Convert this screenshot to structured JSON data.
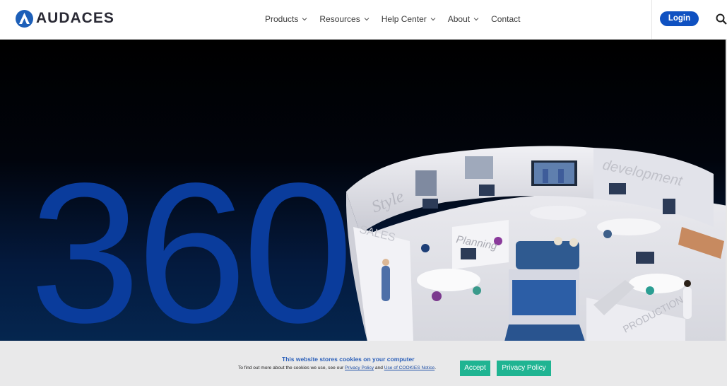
{
  "brand": {
    "name": "AUDACES",
    "color": "#1d5fb8"
  },
  "nav": {
    "items": [
      {
        "label": "Products",
        "has_dropdown": true
      },
      {
        "label": "Resources",
        "has_dropdown": true
      },
      {
        "label": "Help Center",
        "has_dropdown": true
      },
      {
        "label": "About",
        "has_dropdown": true
      },
      {
        "label": "Contact",
        "has_dropdown": false
      }
    ]
  },
  "header": {
    "login_label": "Login",
    "search_icon": "search-icon"
  },
  "hero": {
    "headline": "360",
    "scene_labels": {
      "style": "Style",
      "development": "development",
      "planning": "Planning",
      "sales": "SALES",
      "production": "PRODUCTION"
    }
  },
  "cookie": {
    "title": "This website stores cookies on your computer",
    "text_before": "To find out more about the cookies we use, see our ",
    "privacy_link": "Privacy Policy",
    "text_and": " and ",
    "cookies_link": "Use of COOKIES Notice",
    "text_after": ".",
    "accept_label": "Accept",
    "privacy_button_label": "Privacy Policy",
    "button_color": "#1fb492"
  }
}
